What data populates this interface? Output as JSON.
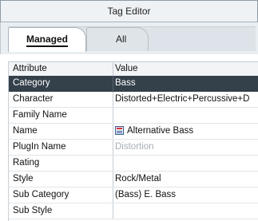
{
  "window": {
    "title": "Tag Editor"
  },
  "tabs": [
    {
      "label": "Managed",
      "active": true
    },
    {
      "label": "All",
      "active": false
    }
  ],
  "table": {
    "columns": [
      "Attribute",
      "Value"
    ],
    "rows": [
      {
        "attribute": "Category",
        "value": "Bass",
        "selected": true
      },
      {
        "attribute": "Character",
        "value": "Distorted+Electric+Percussive+D"
      },
      {
        "attribute": "Family Name",
        "value": ""
      },
      {
        "attribute": "Name",
        "value": "Alternative Bass",
        "icon": "name-tag-icon"
      },
      {
        "attribute": "PlugIn Name",
        "value": "Distortion",
        "muted": true
      },
      {
        "attribute": "Rating",
        "value": ""
      },
      {
        "attribute": "Style",
        "value": "Rock/Metal"
      },
      {
        "attribute": "Sub Category",
        "value": "(Bass) E. Bass"
      },
      {
        "attribute": "Sub Style",
        "value": ""
      }
    ]
  },
  "colors": {
    "selection": "#34404a",
    "muted_text": "#a7adb3"
  }
}
